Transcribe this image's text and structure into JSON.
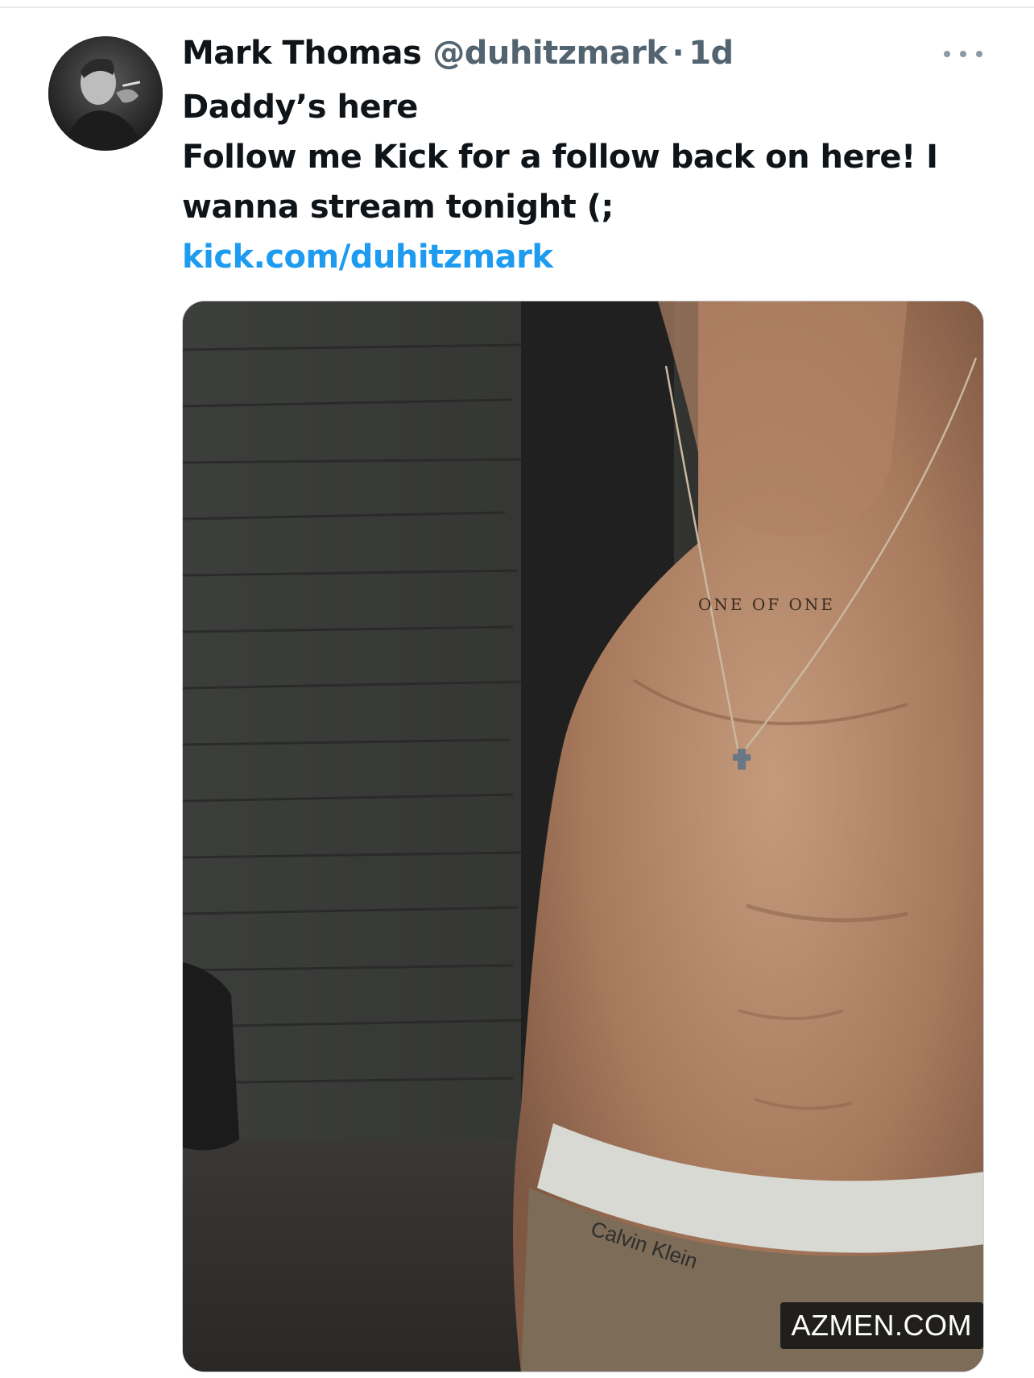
{
  "tweet": {
    "author": {
      "display_name": "Mark Thomas",
      "handle": "@duhitzmark",
      "avatar_icon": "profile-photo-avatar"
    },
    "separator": "·",
    "time": "1d",
    "text_lines": [
      "Daddy’s here",
      "Follow me Kick for a follow back on here! I",
      "wanna stream tonight (;"
    ],
    "link": "kick.com/duhitzmark",
    "more_icon": "more-horizontal-icon",
    "media": {
      "tattoo_text": "ONE OF ONE",
      "waistband_text": "Calvin Klein",
      "watermark": "AZMEN.COM"
    }
  },
  "colors": {
    "text_primary": "#0f1419",
    "text_secondary": "#536471",
    "link": "#1d9bf0",
    "divider": "#e6e8ea"
  }
}
